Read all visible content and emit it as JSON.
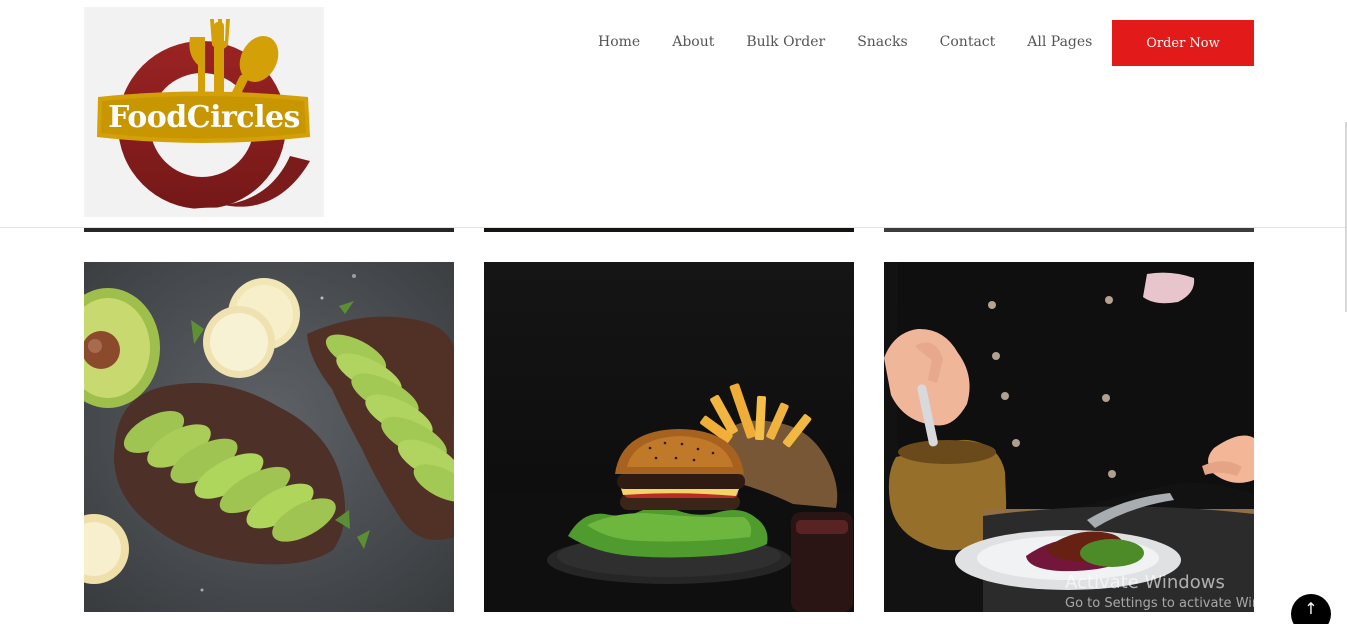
{
  "brand": {
    "name": "FoodCircles",
    "colors": {
      "maroon": "#8f2020",
      "gold": "#d4a008",
      "accent": "#e21a1a"
    }
  },
  "nav": {
    "items": [
      {
        "label": "Home"
      },
      {
        "label": "About"
      },
      {
        "label": "Bulk Order"
      },
      {
        "label": "Snacks"
      },
      {
        "label": "Contact"
      },
      {
        "label": "All Pages"
      }
    ],
    "cta_label": "Order Now"
  },
  "gallery": {
    "images": [
      {
        "name": "avocado-toast"
      },
      {
        "name": "burger-and-fries"
      },
      {
        "name": "chef-plating-steak"
      }
    ]
  },
  "overlay": {
    "activate_title": "Activate Windows",
    "activate_subtitle": "Go to Settings to activate Windows."
  },
  "controls": {
    "scroll_top_icon": "arrow-up-icon"
  }
}
